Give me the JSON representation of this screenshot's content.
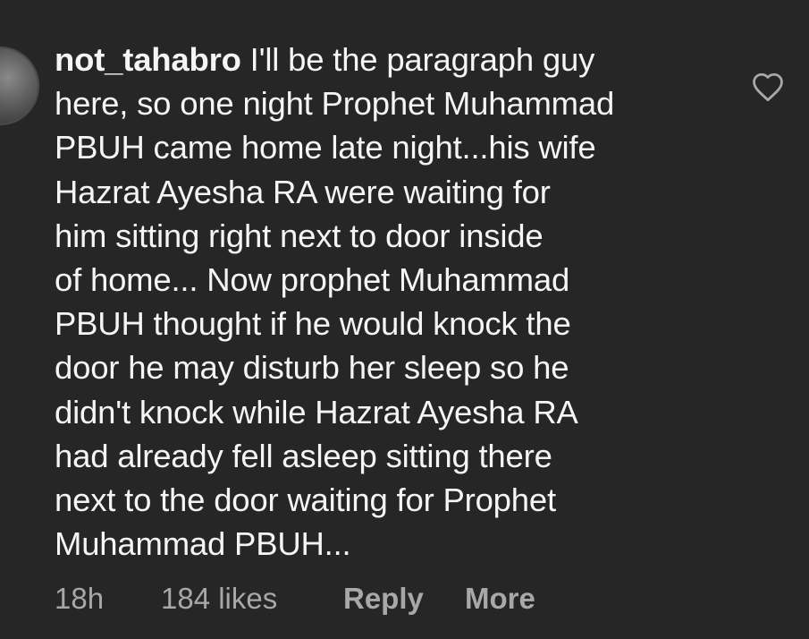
{
  "comment": {
    "username": "not_tahabro",
    "lines": [
      " I'll be the paragraph guy",
      "here, so one night Prophet Muhammad",
      "PBUH came home late night...his wife",
      "Hazrat Ayesha RA were waiting for",
      "him sitting right next to door inside",
      "of home... Now prophet Muhammad",
      "PBUH thought if he would knock the",
      "door he may disturb her sleep so he",
      "didn't knock while Hazrat Ayesha RA",
      "had already fell asleep sitting there",
      "next to the door waiting for Prophet",
      "Muhammad PBUH..."
    ]
  },
  "meta": {
    "time": "18h",
    "likes": "184 likes",
    "reply_label": "Reply",
    "more_label": "More"
  },
  "icons": {
    "like": "heart-outline-icon",
    "avatar": "profile-avatar"
  },
  "colors": {
    "background": "#262626",
    "text": "#f5f5f5",
    "secondary_text": "#a8a8a8"
  }
}
